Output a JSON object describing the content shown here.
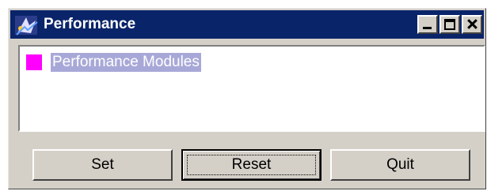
{
  "window": {
    "title": "Performance"
  },
  "list": {
    "items": [
      {
        "label": "Performance Modules",
        "swatch_color": "#ff00ff"
      }
    ]
  },
  "buttons": {
    "set_label": "Set",
    "reset_label": "Reset",
    "quit_label": "Quit"
  },
  "colors": {
    "titlebar": "#0a246a",
    "selection": "#a8a8d8",
    "face": "#d4d0c8"
  }
}
